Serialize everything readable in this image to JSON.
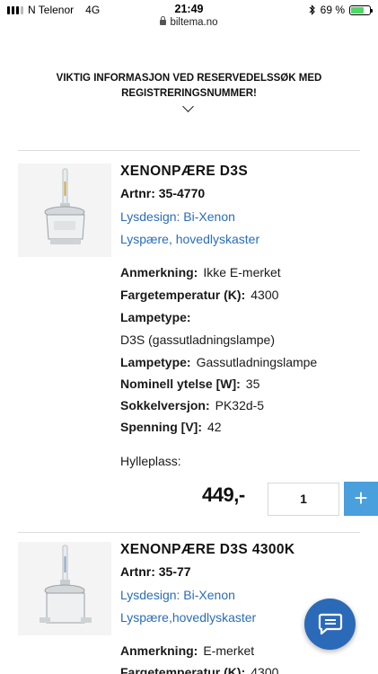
{
  "status_bar": {
    "carrier": "N Telenor",
    "network": "4G",
    "time": "21:49",
    "battery_text": "69 %",
    "battery_level": 0.69,
    "battery_color": "#4cd964"
  },
  "url_bar": {
    "domain": "biltema.no"
  },
  "info_banner": {
    "line1": "VIKTIG INFORMASJON VED RESERVEDELSSØK MED",
    "line2": "REGISTRERINGSNUMMER!"
  },
  "products": [
    {
      "title": "XENONPÆRE D3S",
      "artnr": "Artnr: 35-4770",
      "link1": "Lysdesign: Bi-Xenon",
      "link2": "Lyspære, hovedlyskaster",
      "specs": [
        {
          "label": "Anmerkning:",
          "value": "Ikke E-merket"
        },
        {
          "label": "Fargetemperatur (K):",
          "value": "4300"
        },
        {
          "label": "Lampetype:",
          "value": ""
        },
        {
          "label": "",
          "value": "D3S (gassutladningslampe)"
        },
        {
          "label": "Lampetype:",
          "value": "Gassutladningslampe"
        },
        {
          "label": "Nominell ytelse [W]:",
          "value": "35"
        },
        {
          "label": "Sokkelversjon:",
          "value": "PK32d-5"
        },
        {
          "label": "Spenning [V]:",
          "value": "42"
        }
      ],
      "shelf": "Hylleplass:",
      "price": "449,-",
      "quantity": "1",
      "add_label": "+"
    },
    {
      "title": "XENONPÆRE D3S 4300K",
      "artnr": "Artnr: 35-77",
      "link1": "Lysdesign: Bi-Xenon",
      "link2": "Lyspære,hovedlyskaster",
      "specs": [
        {
          "label": "Anmerkning:",
          "value": "E-merket"
        },
        {
          "label": "Fargetemperatur (K):",
          "value": "4300"
        }
      ]
    }
  ],
  "colors": {
    "link": "#2a6db8",
    "add_button": "#4a9fdd",
    "chat_button": "#2b6ab8"
  },
  "icons": {
    "chat": "chat-bubble-icon",
    "chevron": "chevron-down-icon",
    "lock": "lock-icon",
    "bluetooth": "bluetooth-icon"
  }
}
